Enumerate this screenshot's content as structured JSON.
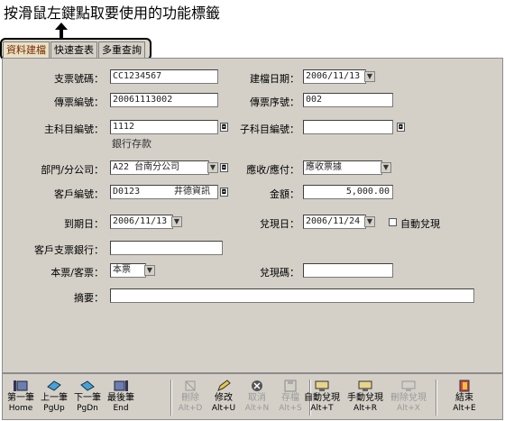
{
  "annotation": "按滑鼠左鍵點取要使用的功能標籤",
  "tabs": [
    {
      "label": "資料建檔",
      "active": true
    },
    {
      "label": "快速查表",
      "active": false
    },
    {
      "label": "多重查詢",
      "active": false
    }
  ],
  "form": {
    "check_no": {
      "label": "支票號碼：",
      "value": "CC1234567"
    },
    "created_date": {
      "label": "建檔日期：",
      "value": "2006/11/13"
    },
    "voucher_no": {
      "label": "傳票編號：",
      "value": "20061113002"
    },
    "voucher_seq": {
      "label": "傳票序號：",
      "value": "002"
    },
    "main_account": {
      "label": "主科目編號：",
      "value": "1112",
      "desc": "銀行存款"
    },
    "sub_account": {
      "label": "子科目編號：",
      "value": ""
    },
    "dept": {
      "label": "部門/分公司：",
      "value": "A22 台南分公司"
    },
    "recv_pay": {
      "label": "應收/應付：",
      "value": "應收票據"
    },
    "customer": {
      "label": "客戶編號：",
      "value": "D0123",
      "name": "井德資訊"
    },
    "amount": {
      "label": "金額：",
      "value": "5,000.00"
    },
    "due_date": {
      "label": "到期日：",
      "value": "2006/11/13"
    },
    "cash_date": {
      "label": "兌現日：",
      "value": "2006/11/24"
    },
    "auto_cash": {
      "label": "自動兌現",
      "checked": false
    },
    "bank": {
      "label": "客戶支票銀行：",
      "value": ""
    },
    "check_type": {
      "label": "本票/客票：",
      "value": "本票"
    },
    "cash_code": {
      "label": "兌現碼：",
      "value": ""
    },
    "memo": {
      "label": "摘要：",
      "value": ""
    }
  },
  "toolbar": {
    "nav": [
      {
        "label": "第一筆",
        "shortcut": "Home",
        "icon": "first-record-icon"
      },
      {
        "label": "上一筆",
        "shortcut": "PgUp",
        "icon": "prev-record-icon"
      },
      {
        "label": "下一筆",
        "shortcut": "PgDn",
        "icon": "next-record-icon"
      },
      {
        "label": "最後筆",
        "shortcut": "End",
        "icon": "last-record-icon"
      }
    ],
    "edit": [
      {
        "label": "刪除",
        "shortcut": "Alt+D",
        "icon": "delete-icon",
        "disabled": true
      },
      {
        "label": "修改",
        "shortcut": "Alt+U",
        "icon": "edit-icon",
        "disabled": false
      },
      {
        "label": "取消",
        "shortcut": "Alt+N",
        "icon": "cancel-icon",
        "disabled": true
      },
      {
        "label": "存檔",
        "shortcut": "Alt+S",
        "icon": "save-icon",
        "disabled": true
      }
    ],
    "cash": [
      {
        "label": "自動兌現",
        "shortcut": "Alt+T",
        "icon": "auto-cash-icon",
        "disabled": false
      },
      {
        "label": "手動兌現",
        "shortcut": "Alt+R",
        "icon": "manual-cash-icon",
        "disabled": false
      },
      {
        "label": "刪除兌現",
        "shortcut": "Alt+X",
        "icon": "delete-cash-icon",
        "disabled": true
      }
    ],
    "exit": {
      "label": "結束",
      "shortcut": "Alt+E",
      "icon": "exit-icon"
    }
  },
  "colors": {
    "panel": "#d4d0c8",
    "active_tab_text": "#7a2a00"
  }
}
